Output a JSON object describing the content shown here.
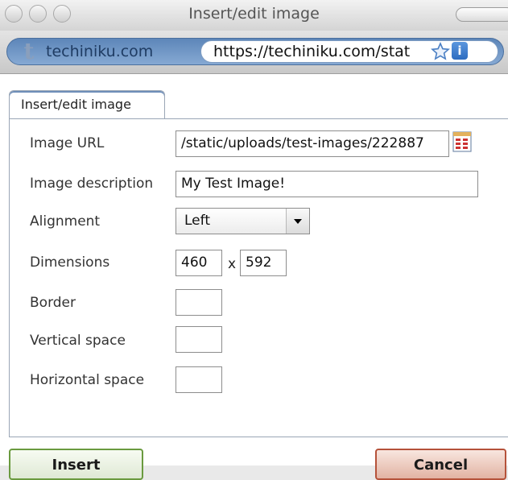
{
  "window": {
    "title": "Insert/edit image"
  },
  "addressbar": {
    "site_icon_letter": "t",
    "site_name": "techiniku.com",
    "url": "https://techiniku.com/stat"
  },
  "dialog": {
    "tab_label": "Insert/edit image",
    "fields": {
      "image_url": {
        "label": "Image URL",
        "value": "/static/uploads/test-images/222887"
      },
      "image_description": {
        "label": "Image description",
        "value": "My Test Image!"
      },
      "alignment": {
        "label": "Alignment",
        "value": "Left"
      },
      "dimensions": {
        "label": "Dimensions",
        "width": "460",
        "separator": "x",
        "height": "592"
      },
      "border": {
        "label": "Border",
        "value": ""
      },
      "vertical_space": {
        "label": "Vertical space",
        "value": ""
      },
      "horizontal_space": {
        "label": "Horizontal space",
        "value": ""
      }
    },
    "buttons": {
      "insert": "Insert",
      "cancel": "Cancel"
    }
  },
  "icons": {
    "star": "star-icon",
    "info": "info-icon",
    "browse": "browse-icon"
  },
  "colors": {
    "address_bar_blue": "#6f95c6",
    "insert_border": "#6a9a3f",
    "cancel_border": "#b5523a"
  }
}
